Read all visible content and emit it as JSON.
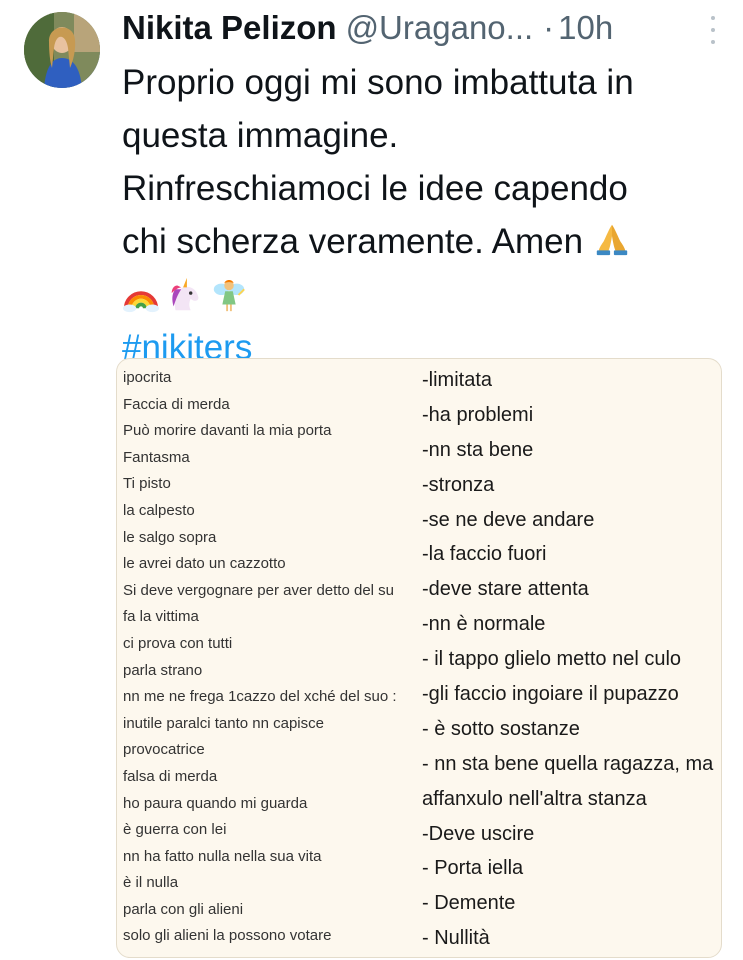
{
  "post": {
    "author_name": "Nikita Pelizon",
    "handle": "@Uragano...",
    "separator": "·",
    "time": "10h",
    "text_lines": [
      "Proprio oggi mi sono imbattuta in",
      "questa immagine.",
      "Rinfreschiamoci le idee capendo",
      "chi scherza veramente. Amen"
    ],
    "emojis": [
      "folded-hands-icon",
      "rainbow-icon",
      "unicorn-icon",
      "fairy-icon"
    ],
    "hashtag": "#nikiters"
  },
  "image": {
    "left_list": [
      "ipocrita",
      "Faccia di merda",
      "Può morire davanti la mia porta",
      "Fantasma",
      "Ti pisto",
      "la calpesto",
      "le salgo sopra",
      "le avrei dato un cazzotto",
      "Si deve vergognare per aver detto del su",
      "fa la vittima",
      "ci prova con tutti",
      "parla strano",
      "nn me ne frega 1cazzo del xché del suo :",
      "inutile paralci tanto nn capisce",
      "provocatrice",
      "falsa di merda",
      "ho paura quando mi guarda",
      "è guerra con lei",
      "nn ha fatto nulla nella sua vita",
      "è il nulla",
      "parla con gli alieni",
      "solo gli alieni la possono votare"
    ],
    "right_list": [
      "-limitata",
      "-ha problemi",
      "-nn sta bene",
      "-stronza",
      "-se ne deve andare",
      "-la faccio fuori",
      "-deve stare attenta",
      "-nn è normale",
      "- il tappo glielo metto nel culo",
      "-gli faccio ingoiare il pupazzo",
      "- è sotto sostanze",
      "- nn sta bene quella ragazza, ma",
      "affanxulo nell'altra stanza",
      "-Deve uscire",
      "- Porta iella",
      "- Demente",
      "- Nullità"
    ]
  },
  "colors": {
    "hashtag": "#1d9bf0",
    "secondary_text": "#536471",
    "card_background": "#fdf8ee"
  }
}
